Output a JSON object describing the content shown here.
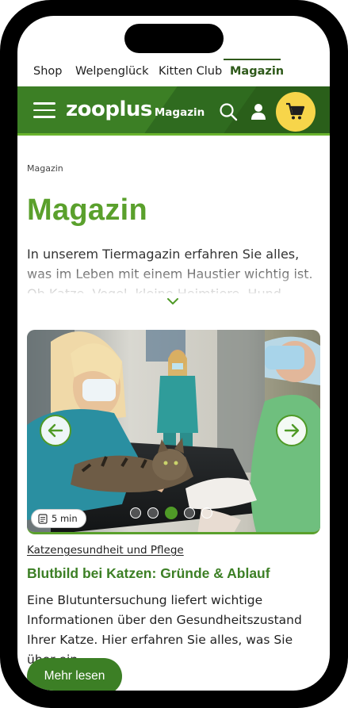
{
  "top_nav": {
    "items": [
      {
        "label": "Shop"
      },
      {
        "label": "Welpenglück"
      },
      {
        "label": "Kitten Club"
      },
      {
        "label": "Magazin",
        "active": true
      }
    ]
  },
  "header": {
    "logo_brand": "zooplus",
    "logo_sub": "Magazin",
    "icons": [
      "menu-icon",
      "search-icon",
      "user-icon",
      "cart-icon"
    ],
    "colors": {
      "bar": "#2f6b1f",
      "accent_line": "#6ab42d",
      "cart": "#f7d54a"
    }
  },
  "breadcrumb": "Magazin",
  "page_title": "Magazin",
  "intro_text": "In unserem Tiermagazin erfahren Sie alles, was im Leben mit einem Haustier wichtig ist. Ob Katze, Vogel, kleine Heimtiere, Hund, Pferd oder",
  "slider": {
    "read_time": "5 min",
    "slide_count": 5,
    "active_slide": 3
  },
  "article": {
    "category": "Katzengesundheit und Pflege",
    "title": "Blutbild bei Katzen: Gründe & Ablauf",
    "text": "Eine Blutuntersuchung liefert wichtige Informationen über den Gesundheitszustand Ihrer Katze. Hier erfahren Sie alles, was Sie über ein",
    "button": "Mehr lesen"
  },
  "theme": {
    "title_green": "#5aa02c",
    "dark_green": "#3c7f25"
  }
}
